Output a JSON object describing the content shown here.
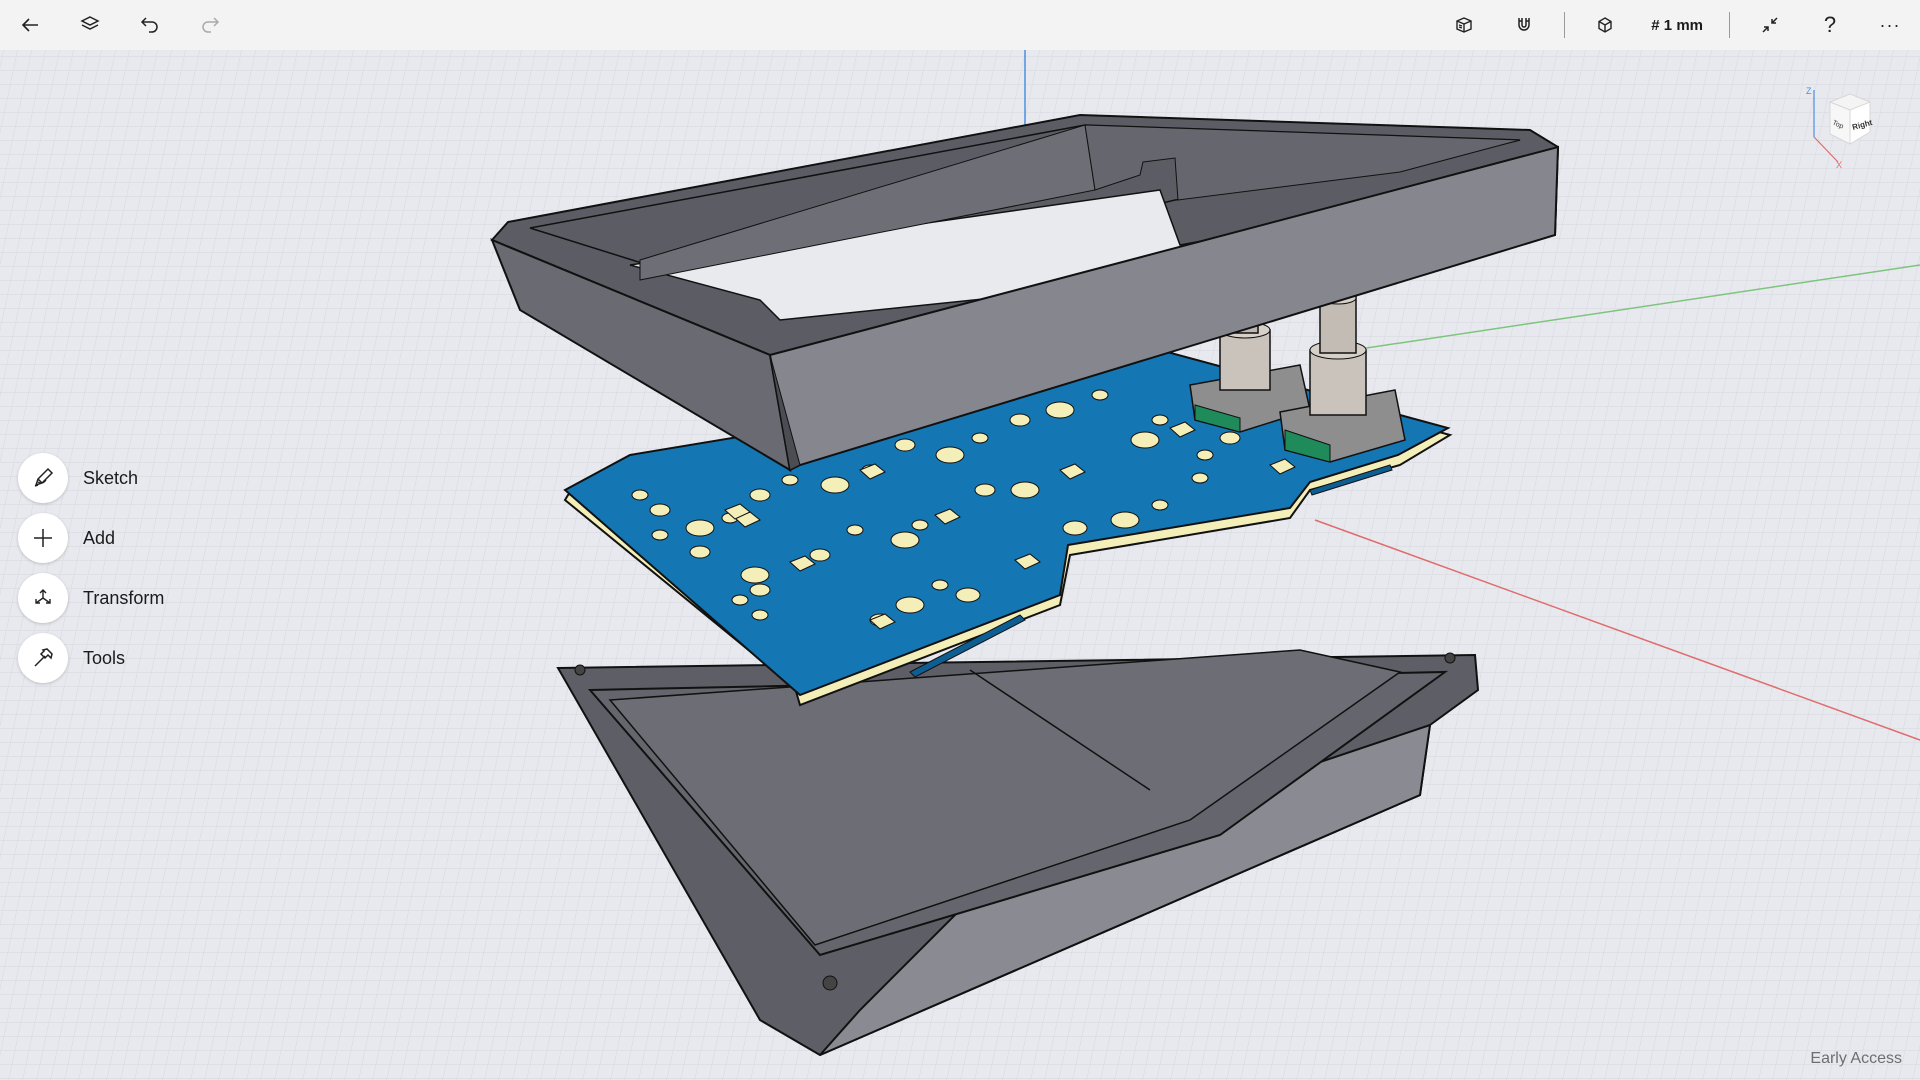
{
  "toolbar": {
    "back_icon": "back-arrow-icon",
    "layers_icon": "layers-icon",
    "undo_icon": "undo-icon",
    "redo_icon": "redo-icon",
    "view_style_icon": "visual-style-icon",
    "snap_icon": "magnet-snap-icon",
    "view_icon": "view-cube-icon",
    "units_label": "# 1 mm",
    "collapse_icon": "collapse-arrows-icon",
    "help_label": "?",
    "more_label": "···"
  },
  "left_menu": {
    "items": [
      {
        "label": "Sketch",
        "icon": "pen-icon"
      },
      {
        "label": "Add",
        "icon": "plus-icon"
      },
      {
        "label": "Transform",
        "icon": "transform-icon"
      },
      {
        "label": "Tools",
        "icon": "hammer-icon"
      }
    ]
  },
  "viewcube": {
    "face_top": "Top",
    "face_right": "Right",
    "axis_z": "Z",
    "axis_x": "X"
  },
  "footer": {
    "status": "Early Access"
  },
  "colors": {
    "pcb_blue": "#1476b3",
    "case_gray": "#76767e",
    "axis_red": "#e06b6b",
    "axis_green": "#7dc47d",
    "axis_blue": "#4a90e2"
  }
}
